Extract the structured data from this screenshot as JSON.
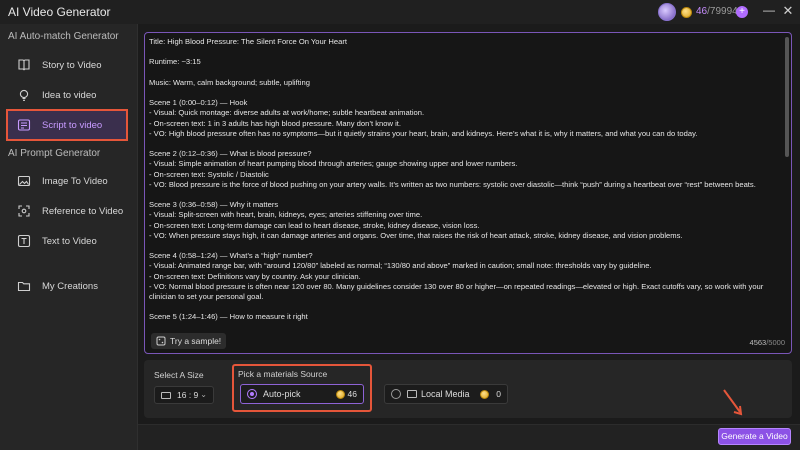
{
  "app": {
    "title": "AI Video Generator",
    "credits_used": "46",
    "credits_sep": "/",
    "credits_total": "79994",
    "plus_label": "+"
  },
  "sidebar": {
    "section1": "AI Auto-match Generator",
    "section2": "AI Prompt Generator",
    "items": [
      {
        "label": "Story to Video",
        "icon": "book-icon"
      },
      {
        "label": "Idea to video",
        "icon": "bulb-icon"
      },
      {
        "label": "Script to video",
        "icon": "script-icon",
        "active": true
      },
      {
        "label": "Image To Video",
        "icon": "image-icon"
      },
      {
        "label": "Reference to Video",
        "icon": "reference-icon"
      },
      {
        "label": "Text to Video",
        "icon": "text-icon"
      },
      {
        "label": "My Creations",
        "icon": "folder-icon"
      }
    ]
  },
  "script": {
    "text": "Title: High Blood Pressure: The Silent Force On Your Heart\n\nRuntime: ~3:15\n\nMusic: Warm, calm background; subtle, uplifting\n\nScene 1 (0:00–0:12) — Hook\n- Visual: Quick montage: diverse adults at work/home; subtle heartbeat animation.\n- On-screen text: 1 in 3 adults has high blood pressure. Many don’t know it.\n- VO: High blood pressure often has no symptoms—but it quietly strains your heart, brain, and kidneys. Here’s what it is, why it matters, and what you can do today.\n\nScene 2 (0:12–0:36) — What is blood pressure?\n- Visual: Simple animation of heart pumping blood through arteries; gauge showing upper and lower numbers.\n- On-screen text: Systolic / Diastolic\n- VO: Blood pressure is the force of blood pushing on your artery walls. It’s written as two numbers: systolic over diastolic—think “push” during a heartbeat over “rest” between beats.\n\nScene 3 (0:36–0:58) — Why it matters\n- Visual: Split-screen with heart, brain, kidneys, eyes; arteries stiffening over time.\n- On-screen text: Long-term damage can lead to heart disease, stroke, kidney disease, vision loss.\n- VO: When pressure stays high, it can damage arteries and organs. Over time, that raises the risk of heart attack, stroke, kidney disease, and vision problems.\n\nScene 4 (0:58–1:24) — What’s a “high” number?\n- Visual: Animated range bar, with “around 120/80” labeled as normal; “130/80 and above” marked in caution; small note: thresholds vary by guideline.\n- On-screen text: Definitions vary by country. Ask your clinician.\n- VO: Normal blood pressure is often near 120 over 80. Many guidelines consider 130 over 80 or higher—on repeated readings—elevated or high. Exact cutoffs vary, so work with your clinician to set your personal goal.\n\nScene 5 (1:24–1:46) — How to measure it right",
    "sample_label": "Try a sample!",
    "char_count": "4563",
    "char_max": "/5000"
  },
  "settings": {
    "size_label": "Select A Size",
    "size_value": "16 : 9",
    "source_label": "Pick a materials Source",
    "options": [
      {
        "label": "Auto-pick",
        "cost": "46",
        "selected": true
      },
      {
        "label": "Local Media",
        "cost": "0",
        "selected": false
      }
    ]
  },
  "actions": {
    "generate_label": "Generate a Video"
  },
  "colors": {
    "accent": "#8c52e6",
    "highlight_box": "#e5563a",
    "active_text": "#c79bff"
  }
}
